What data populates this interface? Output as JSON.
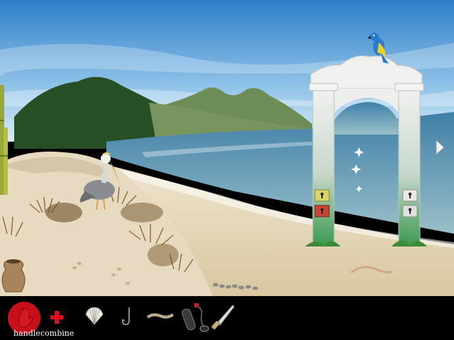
{
  "actions": {
    "handle_label": "handle",
    "combine_label": "combine"
  },
  "inventory": [
    {
      "name": "scallop-shell"
    },
    {
      "name": "fish-hook"
    },
    {
      "name": "rope"
    },
    {
      "name": "diving-gear"
    },
    {
      "name": "knife"
    }
  ],
  "colors": {
    "sky_top": "#2f7fc8",
    "sea": "#5d8fa8",
    "sand": "#e9dcc0",
    "handle_red": "#c8101a",
    "combine_red": "#e0101a"
  },
  "scene": {
    "icons": [
      "parrot",
      "pelican",
      "marble-arch",
      "keyhole-plate",
      "sparkle",
      "clay-jar",
      "bamboo",
      "right-arrow"
    ]
  }
}
